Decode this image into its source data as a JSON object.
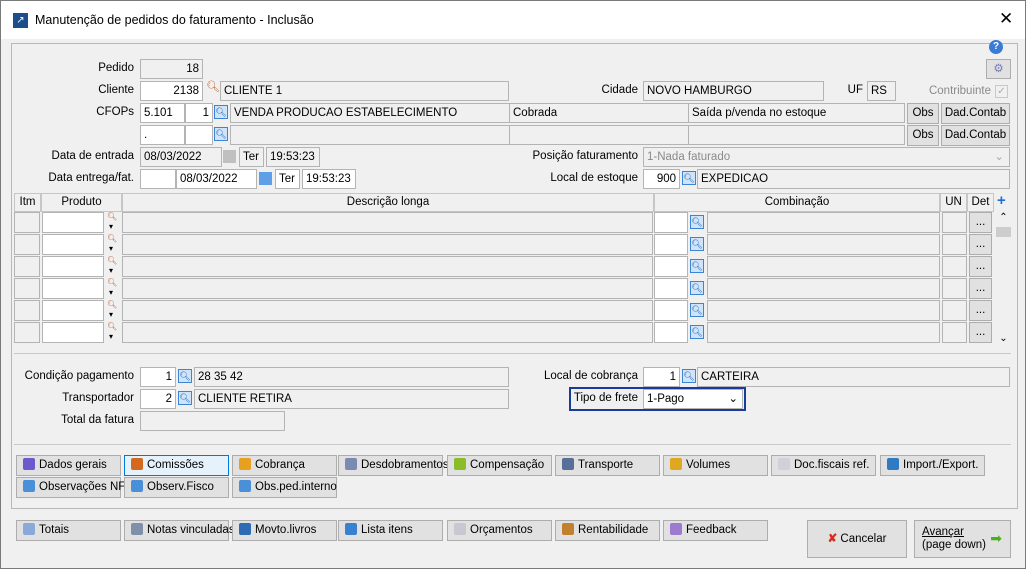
{
  "window": {
    "title": "Manutenção de pedidos do faturamento - Inclusão",
    "close": "✕"
  },
  "header": {
    "pedido_label": "Pedido",
    "pedido": "18",
    "cliente_label": "Cliente",
    "cliente_code": "2138",
    "cliente_name": "CLIENTE 1",
    "cidade_label": "Cidade",
    "cidade": "NOVO HAMBURGO",
    "uf_label": "UF",
    "uf": "RS",
    "contribuinte_label": "Contribuinte",
    "contribuinte_checked": true,
    "cfops_label": "CFOPs",
    "cfops": [
      {
        "code": "5.101",
        "seq": "1",
        "desc": "VENDA PRODUCAO ESTABELECIMENTO",
        "tipo": "Cobrada",
        "mov": "Saída p/venda no estoque"
      },
      {
        "code": ".",
        "seq": "",
        "desc": "",
        "tipo": "",
        "mov": ""
      }
    ],
    "obs_label": "Obs",
    "dadcontab_label": "Dad.Contab",
    "data_entrada_label": "Data de entrada",
    "data_entrada": "08/03/2022",
    "data_entrada_dia": "Ter",
    "data_entrada_hora": "19:53:23",
    "data_entrega_label": "Data entrega/fat.",
    "data_entrega_pre": "",
    "data_entrega": "08/03/2022",
    "data_entrega_dia": "Ter",
    "data_entrega_hora": "19:53:23",
    "posicao_label": "Posição faturamento",
    "posicao": "1-Nada faturado",
    "local_estoque_label": "Local de estoque",
    "local_estoque_code": "900",
    "local_estoque": "EXPEDICAO"
  },
  "grid": {
    "columns": {
      "itm": "Itm",
      "produto": "Produto",
      "descricao": "Descrição longa",
      "combinacao": "Combinação",
      "un": "UN",
      "det": "Det"
    },
    "row_count": 6,
    "det_label": "..."
  },
  "footer": {
    "condicao_label": "Condição pagamento",
    "condicao_code": "1",
    "condicao": "28 35 42",
    "transportador_label": "Transportador",
    "transportador_code": "2",
    "transportador": "CLIENTE RETIRA",
    "total_label": "Total da fatura",
    "total": "",
    "local_cobranca_label": "Local de cobrança",
    "local_cobranca_code": "1",
    "local_cobranca": "CARTEIRA",
    "frete_label": "Tipo de frete",
    "frete": "1-Pago"
  },
  "tabs": [
    {
      "label": "Dados gerais",
      "color": "#6a5acd"
    },
    {
      "label": "Comissões",
      "color": "#d2691e"
    },
    {
      "label": "Cobrança",
      "color": "#e8a020"
    },
    {
      "label": "Desdobramentos",
      "color": "#7a8ab0"
    },
    {
      "label": "Compensação",
      "color": "#8bbd2a"
    },
    {
      "label": "Transporte",
      "color": "#5a6e9a"
    },
    {
      "label": "Volumes",
      "color": "#e0a820"
    },
    {
      "label": "Doc.fiscais ref.",
      "color": "#d0d0d8"
    },
    {
      "label": "Import./Export.",
      "color": "#2e7bc4"
    },
    {
      "label": "Observações NF",
      "color": "#4a90d9"
    },
    {
      "label": "Observ.Fisco",
      "color": "#4a90d9"
    },
    {
      "label": "Obs.ped.interno",
      "color": "#4a90d9"
    }
  ],
  "actions": [
    {
      "label": "Totais",
      "color": "#8aa8d8"
    },
    {
      "label": "Notas vinculadas",
      "color": "#8090a8"
    },
    {
      "label": "Movto.livros",
      "color": "#2d6bb5"
    },
    {
      "label": "Lista itens",
      "color": "#3a80d0"
    },
    {
      "label": "Orçamentos",
      "color": "#c8c8d0"
    },
    {
      "label": "Rentabilidade",
      "color": "#c08030"
    },
    {
      "label": "Feedback",
      "color": "#9c7ad0"
    }
  ],
  "cancel_label": "Cancelar",
  "next_label": "Avançar",
  "next_sub": "(page down)"
}
